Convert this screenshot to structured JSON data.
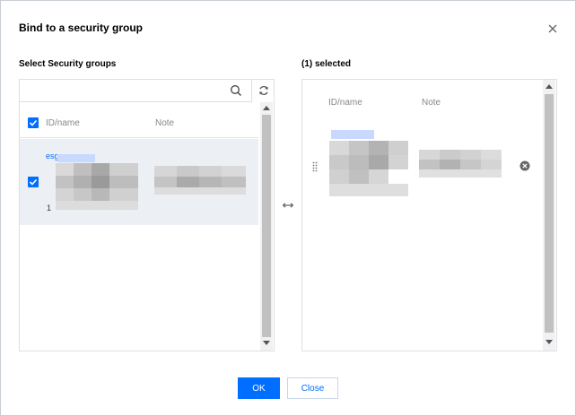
{
  "dialog": {
    "title": "Bind to a security group",
    "close_icon": "close-icon"
  },
  "left": {
    "label": "Select Security groups",
    "search": {
      "value": "",
      "placeholder": ""
    },
    "columns": {
      "id_name": "ID/name",
      "note": "Note"
    },
    "rows": [
      {
        "id_prefix": "esg",
        "extra": "1"
      }
    ]
  },
  "right": {
    "label": "(1) selected",
    "columns": {
      "id_name": "ID/name",
      "note": "Note"
    }
  },
  "colors": {
    "accent": "#006eff",
    "selected_row": "#eceff4",
    "border": "#dcdfe6"
  },
  "footer": {
    "ok_label": "OK",
    "close_label": "Close"
  }
}
